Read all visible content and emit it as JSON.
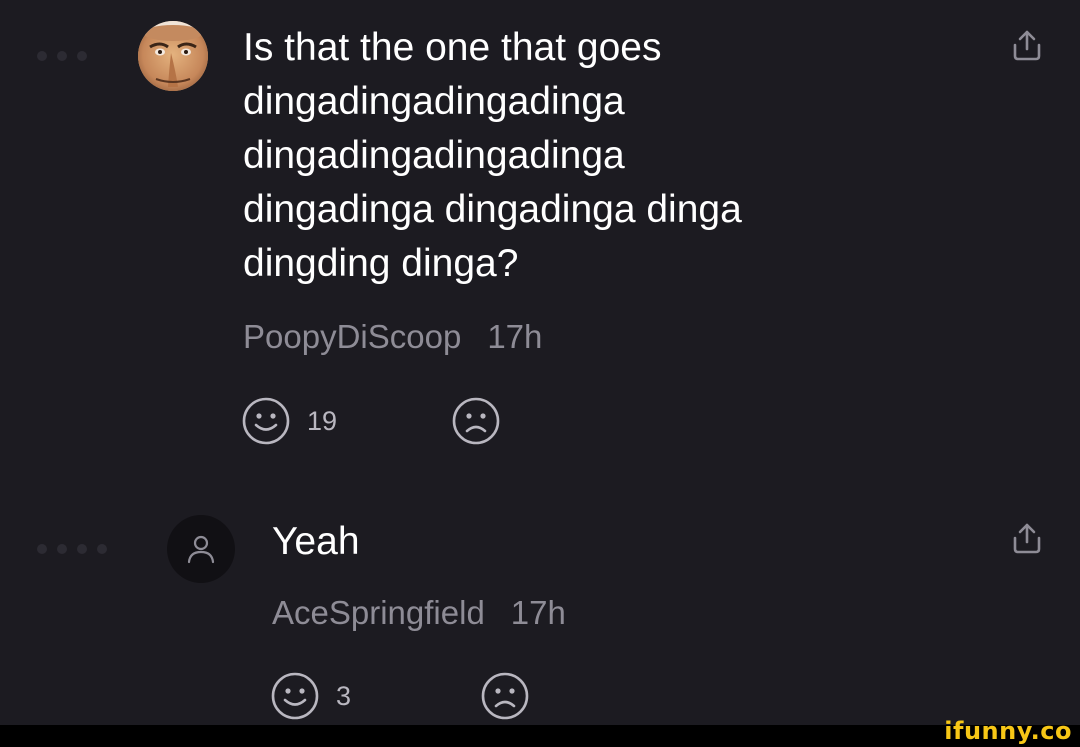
{
  "comments": [
    {
      "text": "Is that the one that goes\ndingadingadingadinga\ndingadingadingadinga\ndingadinga dingadinga dinga\ndingding dinga?",
      "username": "PoopyDiScoop",
      "time": "17h",
      "likes": "19",
      "avatar_icon": "gru-face-avatar",
      "share_icon": "share-icon"
    },
    {
      "text": "Yeah",
      "username": "AceSpringfield",
      "time": "17h",
      "likes": "3",
      "avatar_icon": "user-icon",
      "share_icon": "share-icon"
    }
  ],
  "watermark": "ifunny.co"
}
